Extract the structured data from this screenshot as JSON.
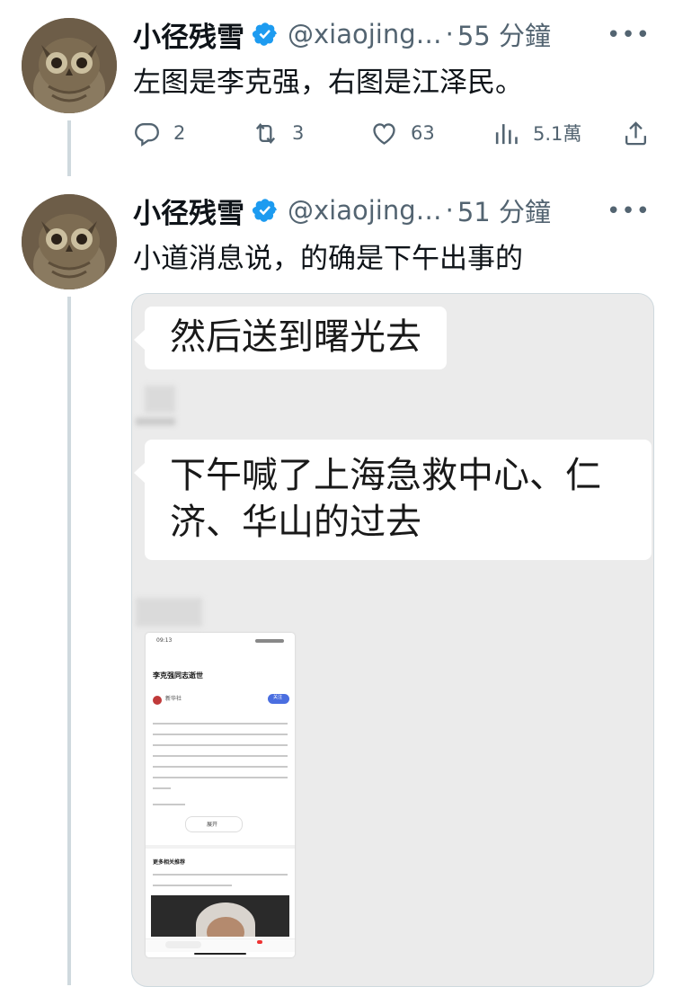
{
  "tweets": [
    {
      "name": "小径残雪",
      "handle": "@xiaojing…",
      "separator": "·",
      "time": "55 分鐘",
      "text": "左图是李克强，右图是江泽民。",
      "stats": {
        "replies": "2",
        "retweets": "3",
        "likes": "63",
        "views": "5.1萬"
      }
    },
    {
      "name": "小径残雪",
      "handle": "@xiaojing…",
      "separator": "·",
      "time": "51 分鐘",
      "text": "小道消息说，的确是下午出事的",
      "media": {
        "bubble1": "然后送到曙光去",
        "bubble2_line1": "下午喊了上海急救中心、仁",
        "bubble2_line2": "济、华山的过去",
        "inner_screenshot": {
          "status_time": "09:13",
          "title": "李克强同志逝世",
          "author": "新华社",
          "follow": "关注",
          "read_more": "展开",
          "section": "更多相关推荐"
        }
      }
    }
  ],
  "icons": {
    "verified": "verified-badge-icon",
    "more": "more-dots-icon",
    "reply": "reply-icon",
    "retweet": "retweet-icon",
    "like": "heart-icon",
    "views": "views-chart-icon",
    "share": "share-icon"
  },
  "colors": {
    "verified_blue": "#1d9bf0",
    "muted_text": "#536471",
    "thread_line": "#cfd9de",
    "chat_bg": "#ebebeb"
  },
  "more_label": "•••"
}
